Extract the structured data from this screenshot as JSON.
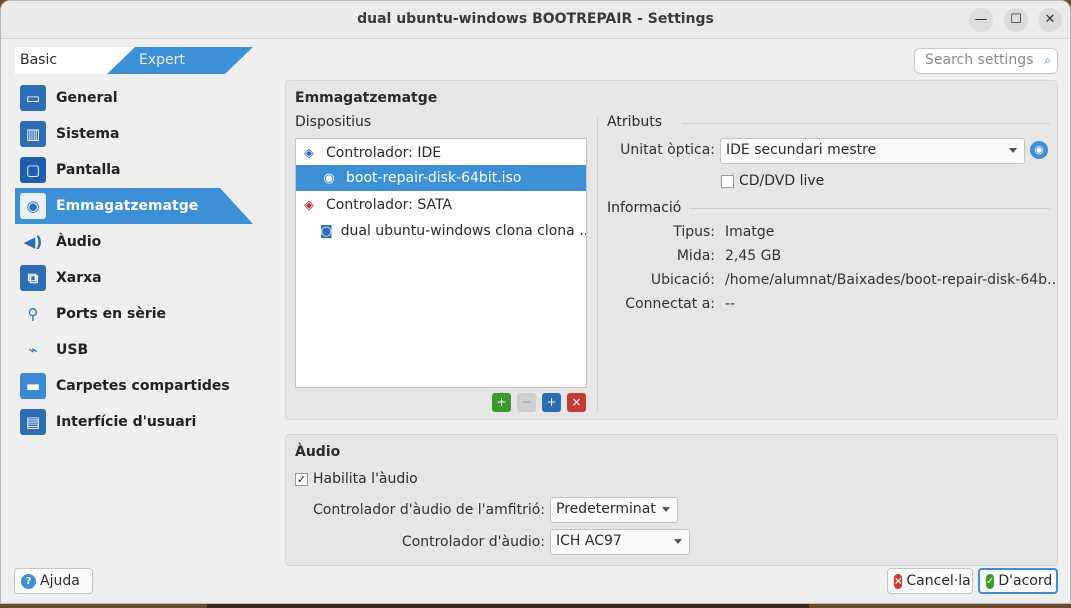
{
  "window": {
    "title": "dual ubuntu-windows BOOTREPAIR - Settings",
    "min": "—",
    "max": "☐",
    "close": "✕"
  },
  "mode": {
    "basic": "Basic",
    "expert": "Expert"
  },
  "search": {
    "placeholder": "Search settings"
  },
  "sidebar": {
    "items": [
      {
        "label": "General",
        "icon": "general-icon"
      },
      {
        "label": "Sistema",
        "icon": "system-icon"
      },
      {
        "label": "Pantalla",
        "icon": "display-icon"
      },
      {
        "label": "Emmagatzematge",
        "icon": "storage-icon"
      },
      {
        "label": "Àudio",
        "icon": "audio-icon"
      },
      {
        "label": "Xarxa",
        "icon": "network-icon"
      },
      {
        "label": "Ports en sèrie",
        "icon": "serial-ports-icon"
      },
      {
        "label": "USB",
        "icon": "usb-icon"
      },
      {
        "label": "Carpetes compartides",
        "icon": "shared-folders-icon"
      },
      {
        "label": "Interfície d'usuari",
        "icon": "user-interface-icon"
      }
    ]
  },
  "storage": {
    "title": "Emmagatzematge",
    "devices_label": "Dispositius",
    "devices": [
      {
        "label": "Controlador: IDE"
      },
      {
        "label": "boot-repair-disk-64bit.iso"
      },
      {
        "label": "Controlador: SATA"
      },
      {
        "label": "dual ubuntu-windows clona clona ..."
      }
    ],
    "attributes_label": "Atributs",
    "optical_label": "Unitat òptica:",
    "optical_value": "IDE secundari mestre",
    "live_label": "CD/DVD live",
    "info_label": "Informació",
    "info": [
      {
        "label": "Tipus:",
        "value": "Imatge"
      },
      {
        "label": "Mida:",
        "value": "2,45 GB"
      },
      {
        "label": "Ubicació:",
        "value": "/home/alumnat/Baixades/boot-repair-disk-64b…"
      },
      {
        "label": "Connectat a:",
        "value": "--"
      }
    ]
  },
  "audio": {
    "title": "Àudio",
    "enable_label": "Habilita l'àudio",
    "host_label": "Controlador d'àudio de l'amfitrió:",
    "host_value": "Predeterminat",
    "ctrl_label": "Controlador d'àudio:",
    "ctrl_value": "ICH AC97"
  },
  "buttons": {
    "help": "Ajuda",
    "cancel": "Cancel·la",
    "ok": "D'acord"
  },
  "colors": {
    "accent": "#3d8fd6"
  }
}
